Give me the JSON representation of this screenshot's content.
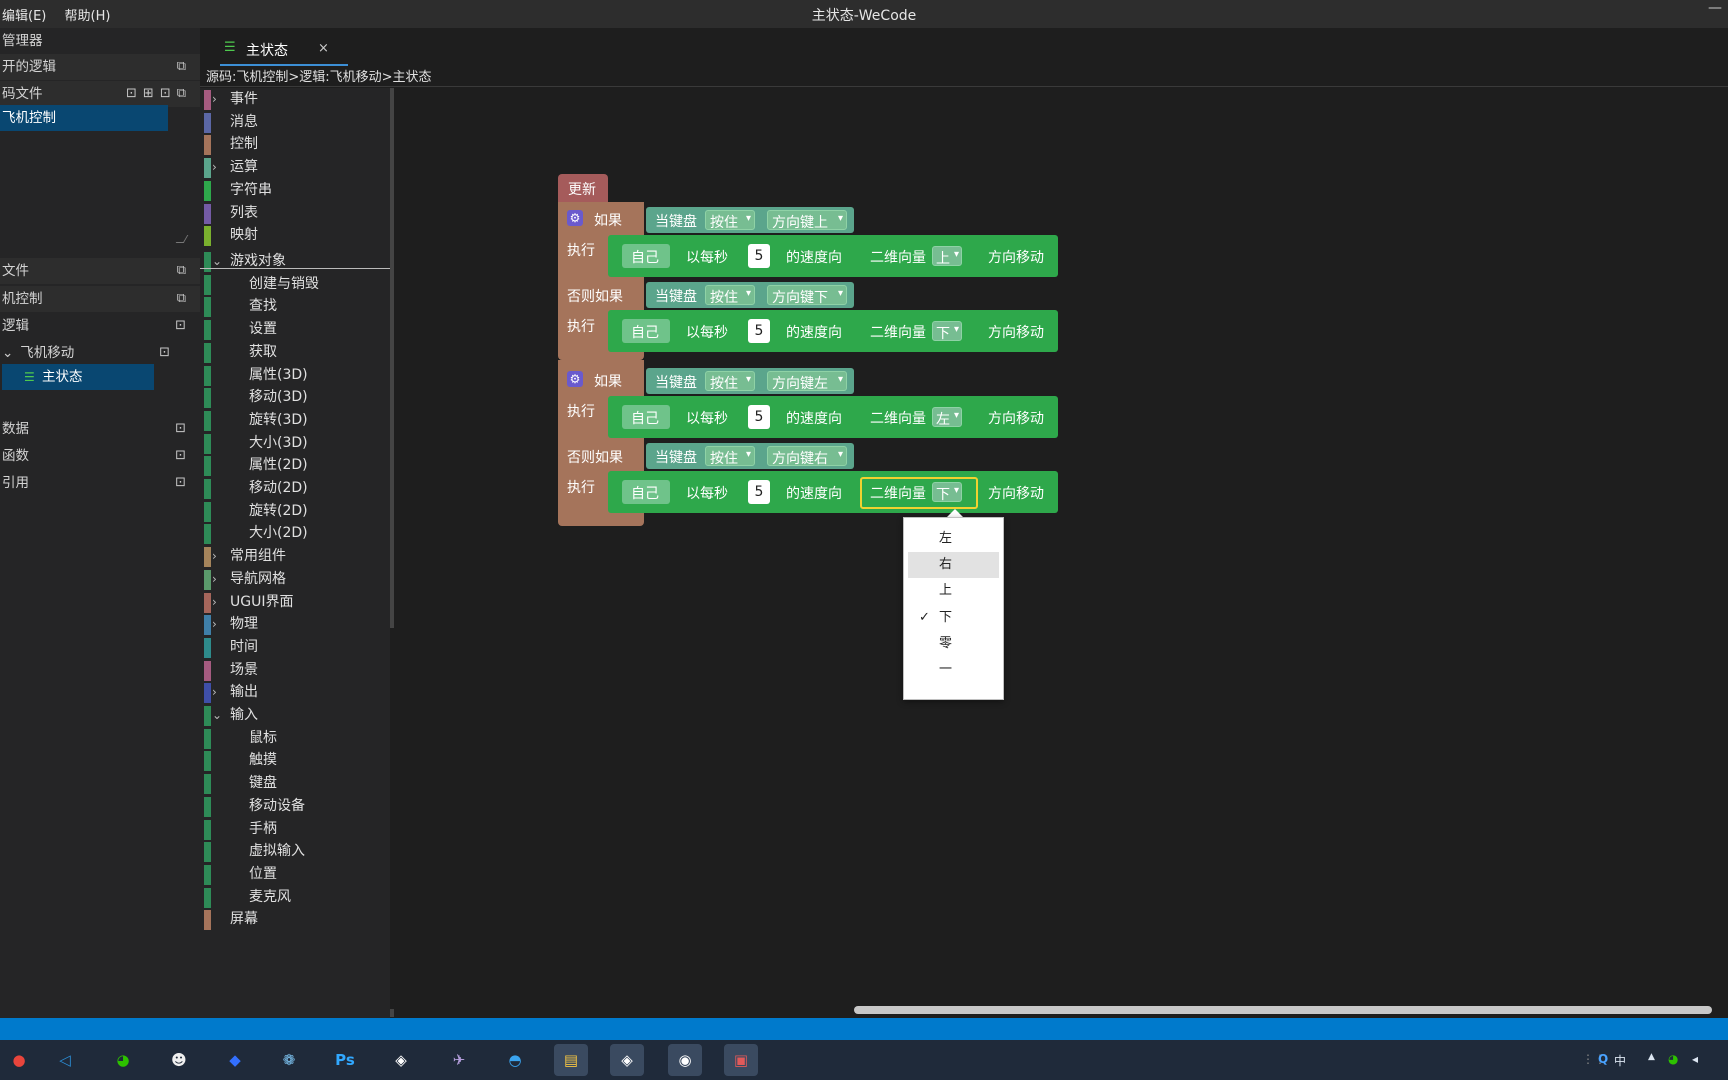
{
  "titlebar": {
    "menu_edit": "编辑(E)",
    "menu_help": "帮助(H)",
    "title": "主状态-WeCode",
    "min": "—"
  },
  "explorer": {
    "header": "管理器",
    "open_logic": "开的逻辑",
    "code_files": "码文件",
    "project_item": "飞机控制",
    "files_header": "文件",
    "project_header": "机控制",
    "logic": "逻辑",
    "logic_child": "飞机移动",
    "state_item": "主状态",
    "data": "数据",
    "functions": "函数",
    "refs": "引用",
    "icon_new": "⊡",
    "icon_collapse": "⧉"
  },
  "tab": {
    "label": "主状态",
    "close": "×",
    "icon": "☰"
  },
  "breadcrumb": "源码:飞机控制>逻辑:飞机移动>主状态",
  "toolbox": {
    "categories": [
      {
        "label": "事件",
        "color": "#a55b80",
        "arrow": "›"
      },
      {
        "label": "消息",
        "color": "#5b67a5",
        "arrow": ""
      },
      {
        "label": "控制",
        "color": "#a5745b",
        "arrow": ""
      },
      {
        "label": "运算",
        "color": "#5ba58c",
        "arrow": "›"
      },
      {
        "label": "字符串",
        "color": "#2ea84b",
        "arrow": ""
      },
      {
        "label": "列表",
        "color": "#745ba5",
        "arrow": ""
      },
      {
        "label": "映射",
        "color": "#7ab02e",
        "arrow": ""
      }
    ],
    "categories2": [
      {
        "label": "游戏对象",
        "color": "#2e8b57",
        "arrow": "⌄",
        "sub": false
      },
      {
        "label": "创建与销毁",
        "color": "#2e8b57",
        "arrow": "",
        "sub": true
      },
      {
        "label": "查找",
        "color": "#2e8b57",
        "arrow": "",
        "sub": true
      },
      {
        "label": "设置",
        "color": "#2e8b57",
        "arrow": "",
        "sub": true
      },
      {
        "label": "获取",
        "color": "#2e8b57",
        "arrow": "",
        "sub": true
      },
      {
        "label": "属性(3D)",
        "color": "#2e8b57",
        "arrow": "",
        "sub": true
      },
      {
        "label": "移动(3D)",
        "color": "#2e8b57",
        "arrow": "",
        "sub": true
      },
      {
        "label": "旋转(3D)",
        "color": "#2e8b57",
        "arrow": "",
        "sub": true
      },
      {
        "label": "大小(3D)",
        "color": "#2e8b57",
        "arrow": "",
        "sub": true
      },
      {
        "label": "属性(2D)",
        "color": "#2e8b57",
        "arrow": "",
        "sub": true
      },
      {
        "label": "移动(2D)",
        "color": "#2e8b57",
        "arrow": "",
        "sub": true
      },
      {
        "label": "旋转(2D)",
        "color": "#2e8b57",
        "arrow": "",
        "sub": true
      },
      {
        "label": "大小(2D)",
        "color": "#2e8b57",
        "arrow": "",
        "sub": true
      },
      {
        "label": "常用组件",
        "color": "#a5845b",
        "arrow": "›",
        "sub": false
      },
      {
        "label": "导航网格",
        "color": "#5b9a6b",
        "arrow": "›",
        "sub": false
      },
      {
        "label": "UGUI界面",
        "color": "#a5665b",
        "arrow": "›",
        "sub": false
      },
      {
        "label": "物理",
        "color": "#3f7fa8",
        "arrow": "›",
        "sub": false
      },
      {
        "label": "时间",
        "color": "#2e8b8b",
        "arrow": "",
        "sub": false
      },
      {
        "label": "场景",
        "color": "#a55b80",
        "arrow": "",
        "sub": false
      },
      {
        "label": "输出",
        "color": "#3f4fa8",
        "arrow": "›",
        "sub": false
      },
      {
        "label": "输入",
        "color": "#2e8b57",
        "arrow": "⌄",
        "sub": false
      },
      {
        "label": "鼠标",
        "color": "#2e8b57",
        "arrow": "",
        "sub": true
      },
      {
        "label": "触摸",
        "color": "#2e8b57",
        "arrow": "",
        "sub": true
      },
      {
        "label": "键盘",
        "color": "#2e8b57",
        "arrow": "",
        "sub": true
      },
      {
        "label": "移动设备",
        "color": "#2e8b57",
        "arrow": "",
        "sub": true
      },
      {
        "label": "手柄",
        "color": "#2e8b57",
        "arrow": "",
        "sub": true
      },
      {
        "label": "虚拟输入",
        "color": "#2e8b57",
        "arrow": "",
        "sub": true
      },
      {
        "label": "位置",
        "color": "#2e8b57",
        "arrow": "",
        "sub": true
      },
      {
        "label": "麦克风",
        "color": "#2e8b57",
        "arrow": "",
        "sub": true
      },
      {
        "label": "屏幕",
        "color": "#a5745b",
        "arrow": "",
        "sub": false
      }
    ]
  },
  "blocks": {
    "hat": "更新",
    "if": "如果",
    "else_if": "否则如果",
    "do": "执行",
    "keyboard": "当键盘",
    "press": "按住",
    "key_up": "方向键上",
    "key_down": "方向键下",
    "key_left": "方向键左",
    "key_right": "方向键右",
    "self": "自己",
    "per_sec": "以每秒",
    "speed": "5",
    "speed_to": "的速度向",
    "vec2": "二维向量",
    "move": "方向移动",
    "dir_up": "上",
    "dir_down": "下",
    "dir_left": "左",
    "dir_sel": "下",
    "dropdown_arrow": "▾",
    "gear": "⚙"
  },
  "popup": {
    "options": [
      "左",
      "右",
      "上",
      "下",
      "零",
      "一"
    ],
    "checked": "下",
    "hovered": "右",
    "check_mark": "✓"
  },
  "cursor": "☝",
  "taskbar": {
    "icons": [
      {
        "name": "chrome",
        "glyph": "●",
        "color": "#e8453c"
      },
      {
        "name": "vscode",
        "glyph": "◁",
        "color": "#2b8fd8"
      },
      {
        "name": "wechat",
        "glyph": "◕",
        "color": "#2dc100"
      },
      {
        "name": "qq",
        "glyph": "☻",
        "color": "#f0f0f0"
      },
      {
        "name": "feishu",
        "glyph": "◆",
        "color": "#3370ff"
      },
      {
        "name": "photos",
        "glyph": "❁",
        "color": "#7cc2f0"
      },
      {
        "name": "photoshop",
        "glyph": "Ps",
        "color": "#31a8ff"
      },
      {
        "name": "unity",
        "glyph": "◈",
        "color": "#ffffff"
      },
      {
        "name": "vs",
        "glyph": "✈",
        "color": "#b39ddb"
      },
      {
        "name": "edge",
        "glyph": "◓",
        "color": "#3aa4f0"
      },
      {
        "name": "explorer",
        "glyph": "▤",
        "color": "#f5c542"
      },
      {
        "name": "unity2",
        "glyph": "◈",
        "color": "#ffffff"
      },
      {
        "name": "obs",
        "glyph": "◉",
        "color": "#ffffff"
      },
      {
        "name": "wecode",
        "glyph": "▣",
        "color": "#e05a5a"
      }
    ]
  },
  "tray": {
    "ime1": "Q",
    "ime2": "中",
    "arrow": "▲"
  }
}
